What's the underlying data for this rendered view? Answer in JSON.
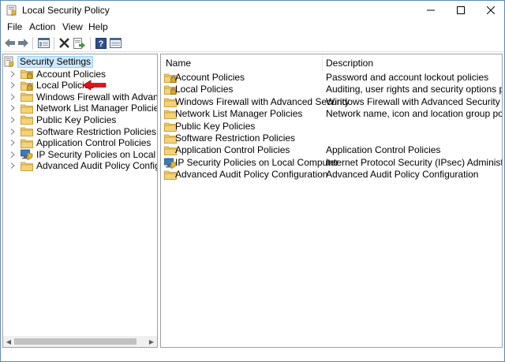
{
  "window": {
    "title": "Local Security Policy"
  },
  "menu": [
    "File",
    "Action",
    "View",
    "Help"
  ],
  "toolbar": {
    "icons": [
      "back-arrow-icon",
      "forward-arrow-icon",
      "show-hide-tree-icon",
      "delete-icon",
      "export-list-icon",
      "help-icon",
      "properties-icon"
    ]
  },
  "tree": {
    "root": "Security Settings",
    "items": [
      {
        "label": "Account Policies",
        "icon": "folder-lock-icon"
      },
      {
        "label": "Local Policies",
        "icon": "folder-lock-icon"
      },
      {
        "label": "Windows Firewall with Advanced Sec",
        "icon": "folder-icon"
      },
      {
        "label": "Network List Manager Policies",
        "icon": "folder-icon"
      },
      {
        "label": "Public Key Policies",
        "icon": "folder-icon"
      },
      {
        "label": "Software Restriction Policies",
        "icon": "folder-icon"
      },
      {
        "label": "Application Control Policies",
        "icon": "folder-icon"
      },
      {
        "label": "IP Security Policies on Local Compute",
        "icon": "ipsec-shield-icon"
      },
      {
        "label": "Advanced Audit Policy Configuration",
        "icon": "folder-icon"
      }
    ]
  },
  "list": {
    "columns": [
      "Name",
      "Description"
    ],
    "rows": [
      {
        "name": "Account Policies",
        "description": "Password and account lockout policies",
        "icon": "folder-lock-icon"
      },
      {
        "name": "Local Policies",
        "description": "Auditing, user rights and security options polici...",
        "icon": "folder-lock-icon"
      },
      {
        "name": "Windows Firewall with Advanced Security",
        "description": "Windows Firewall with Advanced Security",
        "icon": "folder-icon"
      },
      {
        "name": "Network List Manager Policies",
        "description": "Network name, icon and location group policies.",
        "icon": "folder-icon"
      },
      {
        "name": "Public Key Policies",
        "description": "",
        "icon": "folder-icon"
      },
      {
        "name": "Software Restriction Policies",
        "description": "",
        "icon": "folder-icon"
      },
      {
        "name": "Application Control Policies",
        "description": "Application Control Policies",
        "icon": "folder-icon"
      },
      {
        "name": "IP Security Policies on Local Computer",
        "description": "Internet Protocol Security (IPsec) Administratio...",
        "icon": "ipsec-shield-icon"
      },
      {
        "name": "Advanced Audit Policy Configuration",
        "description": "Advanced Audit Policy Configuration",
        "icon": "folder-icon"
      }
    ]
  },
  "colors": {
    "folder": "#e8c15a",
    "selection": "#cce8ff",
    "annotation_arrow": "#e0131a",
    "border": "#a0a0a0"
  }
}
